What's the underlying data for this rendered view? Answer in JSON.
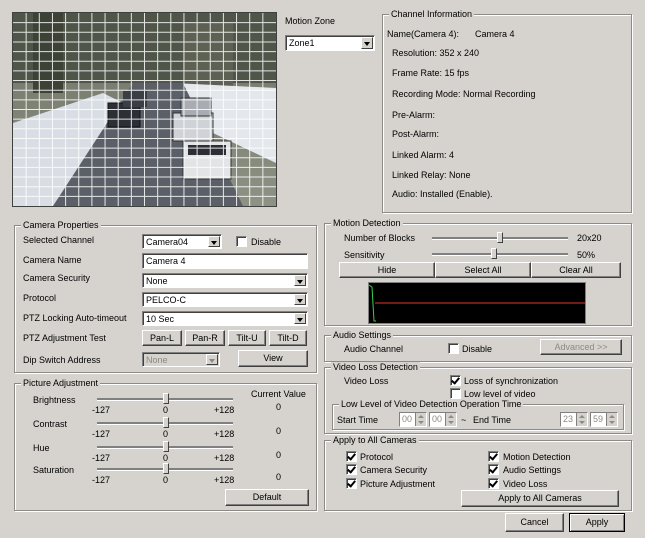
{
  "motion_zone": {
    "label": "Motion Zone",
    "selected": "Zone1"
  },
  "channel_info": {
    "title": "Channel Information",
    "name_label": "Name(Camera 4):",
    "name_value": "Camera 4",
    "resolution": "Resolution: 352 x 240",
    "frame_rate": "Frame Rate: 15 fps",
    "recording_mode": "Recording Mode: Normal Recording",
    "pre_alarm": "Pre-Alarm:",
    "post_alarm": "Post-Alarm:",
    "linked_alarm": "Linked Alarm: 4",
    "linked_relay": "Linked Relay: None",
    "audio": "Audio: Installed (Enable)."
  },
  "camera_properties": {
    "title": "Camera Properties",
    "selected_channel_label": "Selected Channel",
    "selected_channel": "Camera04",
    "disable_label": "Disable",
    "camera_name_label": "Camera Name",
    "camera_name": "Camera 4",
    "camera_security_label": "Camera Security",
    "camera_security": "None",
    "protocol_label": "Protocol",
    "protocol": "PELCO-C",
    "ptz_timeout_label": "PTZ Locking Auto-timeout",
    "ptz_timeout": "10 Sec",
    "ptz_test_label": "PTZ Adjustment Test",
    "pan_l": "Pan-L",
    "pan_r": "Pan-R",
    "tilt_u": "Tilt-U",
    "tilt_d": "Tilt-D",
    "dip_label": "Dip Switch Address",
    "dip_value": "None",
    "view": "View"
  },
  "picture_adjustment": {
    "title": "Picture Adjustment",
    "current_value_label": "Current Value",
    "min": "-127",
    "mid": "0",
    "max": "+128",
    "brightness_label": "Brightness",
    "brightness_value": "0",
    "contrast_label": "Contrast",
    "contrast_value": "0",
    "hue_label": "Hue",
    "hue_value": "0",
    "saturation_label": "Saturation",
    "saturation_value": "0",
    "default": "Default"
  },
  "motion_detection": {
    "title": "Motion Detection",
    "blocks_label": "Number of Blocks",
    "blocks_value": "20x20",
    "sensitivity_label": "Sensitivity",
    "sensitivity_value": "50%",
    "hide": "Hide",
    "select_all": "Select All",
    "clear_all": "Clear All",
    "line_colors": {
      "trace": "#39d14a",
      "threshold": "#e23a2a",
      "bg": "#000000"
    }
  },
  "audio_settings": {
    "title": "Audio Settings",
    "channel_label": "Audio Channel",
    "disable_label": "Disable",
    "advanced": "Advanced >>"
  },
  "video_loss": {
    "title": "Video Loss Detection",
    "label": "Video Loss",
    "loss_sync": "Loss of synchronization",
    "low_level": "Low level of video",
    "low_level_group": "Low Level of Video Detection Operation Time",
    "start_label": "Start Time",
    "start_h": "00",
    "start_m": "00",
    "tilde": "~",
    "end_label": "End Time",
    "end_h": "23",
    "end_m": "59"
  },
  "apply_all": {
    "title": "Apply to All Cameras",
    "protocol": "Protocol",
    "camera_security": "Camera Security",
    "picture_adjustment": "Picture Adjustment",
    "motion_detection": "Motion Detection",
    "audio_settings": "Audio Settings",
    "video_loss": "Video Loss",
    "button": "Apply to All Cameras"
  },
  "footer": {
    "cancel": "Cancel",
    "apply": "Apply"
  }
}
